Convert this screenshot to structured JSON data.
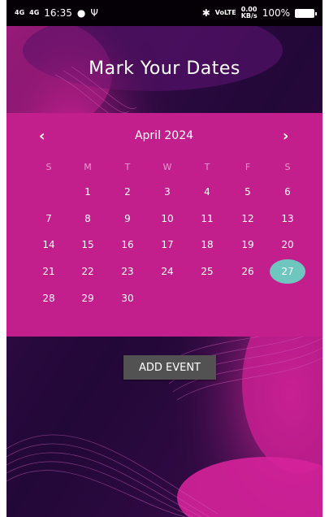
{
  "status_bar": {
    "signal1": "4G",
    "signal2": "4G",
    "time": "16:35",
    "speed_top": "0.00",
    "speed_bottom": "KB/s",
    "lte_top": "VoLTE",
    "battery_percent": "100%"
  },
  "page": {
    "title": "Mark Your Dates"
  },
  "calendar": {
    "prev_icon": "‹",
    "next_icon": "›",
    "month_label": "April 2024",
    "weekdays": [
      "S",
      "M",
      "T",
      "W",
      "T",
      "F",
      "S"
    ],
    "days": [
      "1",
      "2",
      "3",
      "4",
      "5",
      "6",
      "7",
      "8",
      "9",
      "10",
      "11",
      "12",
      "13",
      "14",
      "15",
      "16",
      "17",
      "18",
      "19",
      "20",
      "21",
      "22",
      "23",
      "24",
      "25",
      "26",
      "27",
      "28",
      "29",
      "30"
    ],
    "first_weekday_index": 1,
    "selected_day": "27",
    "selected_color": "#6fc6be",
    "accent_color": "#c21f8d"
  },
  "actions": {
    "add_event_label": "ADD EVENT"
  }
}
